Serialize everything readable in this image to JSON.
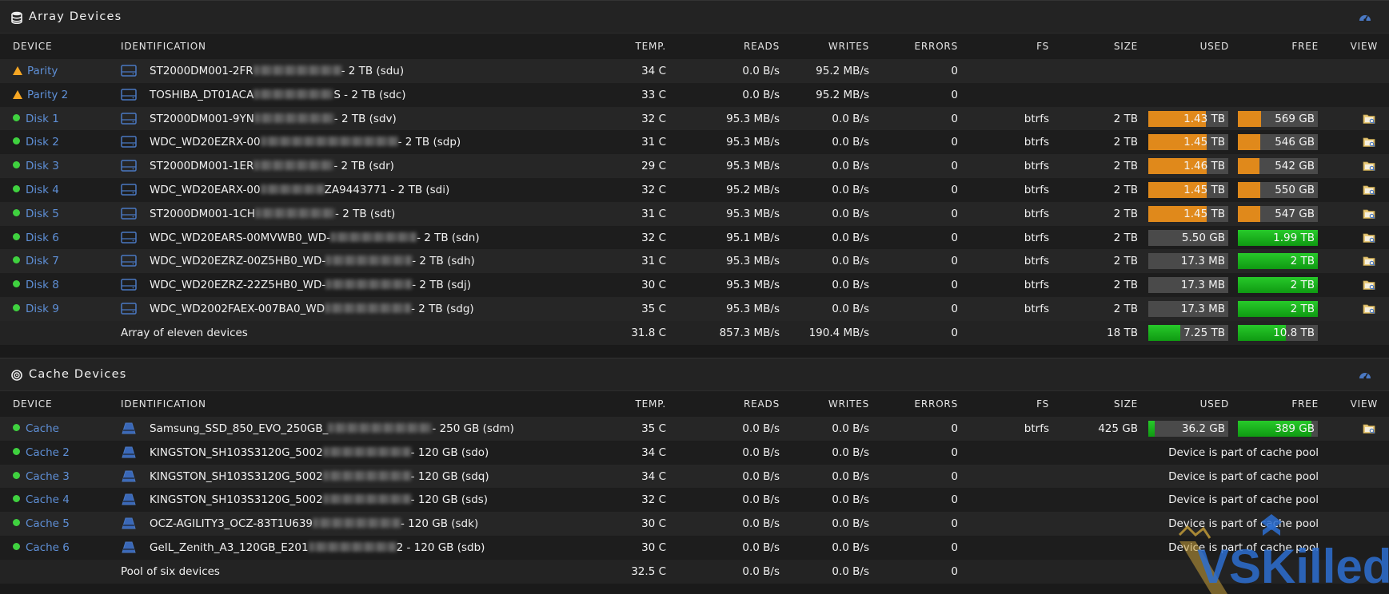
{
  "array": {
    "title": "Array Devices",
    "headers": {
      "device": "DEVICE",
      "identification": "IDENTIFICATION",
      "temp": "TEMP.",
      "reads": "READS",
      "writes": "WRITES",
      "errors": "ERRORS",
      "fs": "FS",
      "size": "SIZE",
      "used": "USED",
      "free": "FREE",
      "view": "VIEW"
    },
    "rows": [
      {
        "device": "Parity",
        "status": "warning",
        "id_pre": "ST2000DM001-2FR",
        "blur_w": 110,
        "id_post": "- 2 TB (sdu)",
        "temp": "34 C",
        "reads": "0.0 B/s",
        "writes": "95.2 MB/s",
        "errors": "0",
        "fs": "",
        "size": "",
        "used": "",
        "free": "",
        "used_pct": 0,
        "free_pct": 0
      },
      {
        "device": "Parity 2",
        "status": "warning",
        "id_pre": "TOSHIBA_DT01ACA",
        "blur_w": 100,
        "id_post": "S - 2 TB (sdc)",
        "temp": "33 C",
        "reads": "0.0 B/s",
        "writes": "95.2 MB/s",
        "errors": "0",
        "fs": "",
        "size": "",
        "used": "",
        "free": "",
        "used_pct": 0,
        "free_pct": 0
      },
      {
        "device": "Disk 1",
        "status": "ok",
        "id_pre": "ST2000DM001-9YN",
        "blur_w": 100,
        "id_post": "- 2 TB (sdv)",
        "temp": "32 C",
        "reads": "95.3 MB/s",
        "writes": "0.0 B/s",
        "errors": "0",
        "fs": "btrfs",
        "size": "2 TB",
        "used": "1.43 TB",
        "free": "569 GB",
        "used_pct": 71.5,
        "free_pct": 28.5,
        "used_color": "orange",
        "free_color": "orange"
      },
      {
        "device": "Disk 2",
        "status": "ok",
        "id_pre": "WDC_WD20EZRX-00",
        "blur_w": 172,
        "id_post": "- 2 TB (sdp)",
        "temp": "31 C",
        "reads": "95.3 MB/s",
        "writes": "0.0 B/s",
        "errors": "0",
        "fs": "btrfs",
        "size": "2 TB",
        "used": "1.45 TB",
        "free": "546 GB",
        "used_pct": 72.5,
        "free_pct": 27.5,
        "used_color": "orange",
        "free_color": "orange"
      },
      {
        "device": "Disk 3",
        "status": "ok",
        "id_pre": "ST2000DM001-1ER",
        "blur_w": 100,
        "id_post": "- 2 TB (sdr)",
        "temp": "29 C",
        "reads": "95.3 MB/s",
        "writes": "0.0 B/s",
        "errors": "0",
        "fs": "btrfs",
        "size": "2 TB",
        "used": "1.46 TB",
        "free": "542 GB",
        "used_pct": 73,
        "free_pct": 27,
        "used_color": "orange",
        "free_color": "orange"
      },
      {
        "device": "Disk 4",
        "status": "ok",
        "id_pre": "WDC_WD20EARX-00",
        "blur_w": 80,
        "id_post": "ZA9443771 - 2 TB (sdi)",
        "temp": "32 C",
        "reads": "95.2 MB/s",
        "writes": "0.0 B/s",
        "errors": "0",
        "fs": "btrfs",
        "size": "2 TB",
        "used": "1.45 TB",
        "free": "550 GB",
        "used_pct": 72.5,
        "free_pct": 27.5,
        "used_color": "orange",
        "free_color": "orange"
      },
      {
        "device": "Disk 5",
        "status": "ok",
        "id_pre": "ST2000DM001-1CH",
        "blur_w": 100,
        "id_post": "- 2 TB (sdt)",
        "temp": "31 C",
        "reads": "95.3 MB/s",
        "writes": "0.0 B/s",
        "errors": "0",
        "fs": "btrfs",
        "size": "2 TB",
        "used": "1.45 TB",
        "free": "547 GB",
        "used_pct": 72.5,
        "free_pct": 27.5,
        "used_color": "orange",
        "free_color": "orange"
      },
      {
        "device": "Disk 6",
        "status": "ok",
        "id_pre": "WDC_WD20EARS-00MVWB0_WD-",
        "blur_w": 108,
        "id_post": "- 2 TB (sdn)",
        "temp": "32 C",
        "reads": "95.1 MB/s",
        "writes": "0.0 B/s",
        "errors": "0",
        "fs": "btrfs",
        "size": "2 TB",
        "used": "5.50 GB",
        "free": "1.99 TB",
        "used_pct": 0,
        "free_pct": 100,
        "used_color": "green",
        "free_color": "green"
      },
      {
        "device": "Disk 7",
        "status": "ok",
        "id_pre": "WDC_WD20EZRZ-00Z5HB0_WD-",
        "blur_w": 108,
        "id_post": "- 2 TB (sdh)",
        "temp": "31 C",
        "reads": "95.3 MB/s",
        "writes": "0.0 B/s",
        "errors": "0",
        "fs": "btrfs",
        "size": "2 TB",
        "used": "17.3 MB",
        "free": "2 TB",
        "used_pct": 0,
        "free_pct": 100,
        "used_color": "green",
        "free_color": "green"
      },
      {
        "device": "Disk 8",
        "status": "ok",
        "id_pre": "WDC_WD20EZRZ-22Z5HB0_WD-",
        "blur_w": 108,
        "id_post": "- 2 TB (sdj)",
        "temp": "30 C",
        "reads": "95.3 MB/s",
        "writes": "0.0 B/s",
        "errors": "0",
        "fs": "btrfs",
        "size": "2 TB",
        "used": "17.3 MB",
        "free": "2 TB",
        "used_pct": 0,
        "free_pct": 100,
        "used_color": "green",
        "free_color": "green"
      },
      {
        "device": "Disk 9",
        "status": "ok",
        "id_pre": "WDC_WD2002FAEX-007BA0_WD",
        "blur_w": 108,
        "id_post": "- 2 TB (sdg)",
        "temp": "35 C",
        "reads": "95.3 MB/s",
        "writes": "0.0 B/s",
        "errors": "0",
        "fs": "btrfs",
        "size": "2 TB",
        "used": "17.3 MB",
        "free": "2 TB",
        "used_pct": 0,
        "free_pct": 100,
        "used_color": "green",
        "free_color": "green"
      }
    ],
    "total": {
      "label": "Array of eleven devices",
      "temp": "31.8 C",
      "reads": "857.3 MB/s",
      "writes": "190.4 MB/s",
      "errors": "0",
      "size": "18 TB",
      "used": "7.25 TB",
      "free": "10.8 TB",
      "used_pct": 40,
      "free_pct": 60
    }
  },
  "cache": {
    "title": "Cache Devices",
    "headers": {
      "device": "DEVICE",
      "identification": "IDENTIFICATION",
      "temp": "TEMP.",
      "reads": "READS",
      "writes": "WRITES",
      "errors": "ERRORS",
      "fs": "FS",
      "size": "SIZE",
      "used": "USED",
      "free": "FREE",
      "view": "VIEW"
    },
    "rows": [
      {
        "device": "Cache",
        "id_pre": "Samsung_SSD_850_EVO_250GB_",
        "blur_w": 130,
        "id_post": "- 250 GB (sdm)",
        "temp": "35 C",
        "reads": "0.0 B/s",
        "writes": "0.0 B/s",
        "errors": "0",
        "fs": "btrfs",
        "size": "425 GB",
        "used": "36.2 GB",
        "free": "389 GB",
        "used_pct": 8,
        "free_pct": 92,
        "pool": ""
      },
      {
        "device": "Cache 2",
        "id_pre": "KINGSTON_SH103S3120G_5002",
        "blur_w": 110,
        "id_post": "- 120 GB (sdo)",
        "temp": "34 C",
        "reads": "0.0 B/s",
        "writes": "0.0 B/s",
        "errors": "0",
        "pool": "Device is part of cache pool"
      },
      {
        "device": "Cache 3",
        "id_pre": "KINGSTON_SH103S3120G_5002",
        "blur_w": 110,
        "id_post": "- 120 GB (sdq)",
        "temp": "34 C",
        "reads": "0.0 B/s",
        "writes": "0.0 B/s",
        "errors": "0",
        "pool": "Device is part of cache pool"
      },
      {
        "device": "Cache 4",
        "id_pre": "KINGSTON_SH103S3120G_5002",
        "blur_w": 110,
        "id_post": "- 120 GB (sds)",
        "temp": "32 C",
        "reads": "0.0 B/s",
        "writes": "0.0 B/s",
        "errors": "0",
        "pool": "Device is part of cache pool"
      },
      {
        "device": "Cache 5",
        "id_pre": "OCZ-AGILITY3_OCZ-83T1U639",
        "blur_w": 110,
        "id_post": "- 120 GB (sdk)",
        "temp": "30 C",
        "reads": "0.0 B/s",
        "writes": "0.0 B/s",
        "errors": "0",
        "pool": "Device is part of cache pool"
      },
      {
        "device": "Cache 6",
        "id_pre": "GeIL_Zenith_A3_120GB_E201",
        "blur_w": 110,
        "id_post": "2 - 120 GB (sdb)",
        "temp": "30 C",
        "reads": "0.0 B/s",
        "writes": "0.0 B/s",
        "errors": "0",
        "pool": "Device is part of cache pool"
      }
    ],
    "total": {
      "label": "Pool of six devices",
      "temp": "32.5 C",
      "reads": "0.0 B/s",
      "writes": "0.0 B/s",
      "errors": "0"
    }
  },
  "watermark": {
    "text": "VSKilled"
  },
  "colors": {
    "link": "#5e8fd6",
    "ok": "#3fd13f",
    "warning": "#f5a623",
    "used_orange": "#e0891b",
    "free_green": "#1aaa1d"
  }
}
